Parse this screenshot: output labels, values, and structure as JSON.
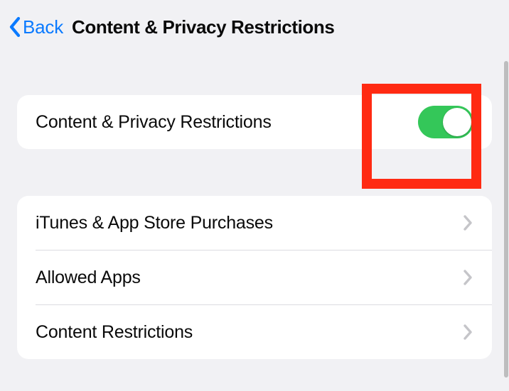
{
  "nav": {
    "back_label": "Back",
    "title": "Content & Privacy Restrictions"
  },
  "toggle_row": {
    "label": "Content & Privacy Restrictions",
    "enabled": true
  },
  "list": [
    {
      "label": "iTunes & App Store Purchases"
    },
    {
      "label": "Allowed Apps"
    },
    {
      "label": "Content Restrictions"
    }
  ],
  "colors": {
    "accent_blue": "#0a7aff",
    "toggle_green": "#34c759",
    "annotation_red": "#ff2a12"
  }
}
